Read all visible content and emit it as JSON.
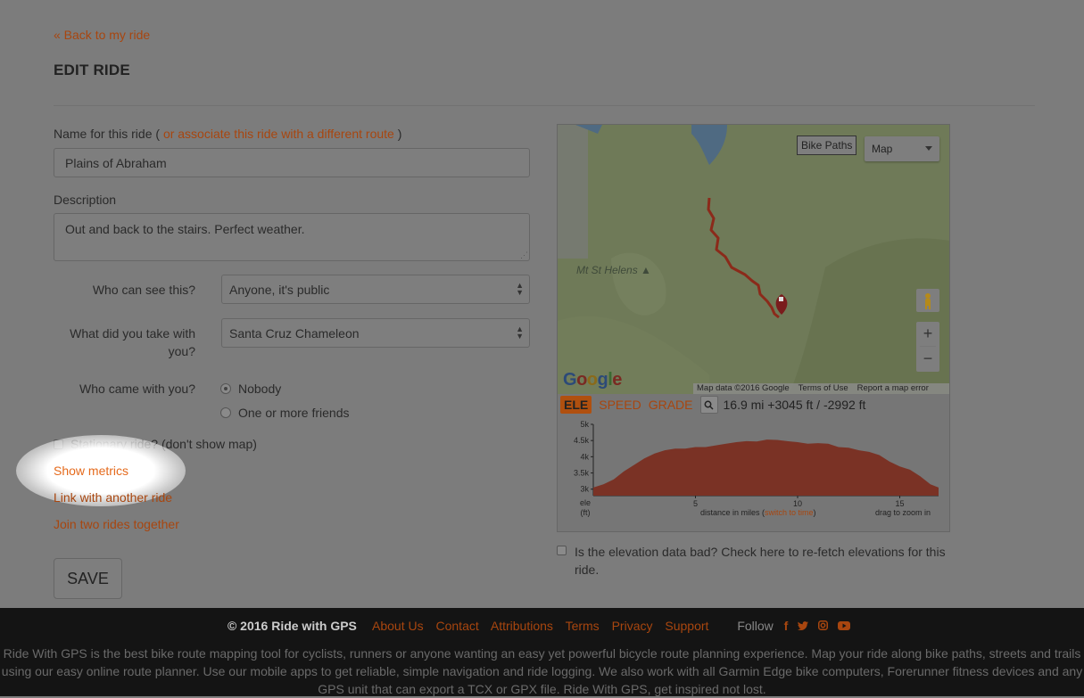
{
  "nav": {
    "back_link": "« Back to my ride"
  },
  "page": {
    "title": "EDIT RIDE"
  },
  "form": {
    "name_label": "Name for this ride",
    "name_label_open": "(",
    "name_label_close": ")",
    "associate_link": "or associate this ride with a different route",
    "name_value": "Plains of Abraham",
    "description_label": "Description",
    "description_value": "Out and back to the stairs. Perfect weather.",
    "visibility_label": "Who can see this?",
    "visibility_value": "Anyone, it's public",
    "gear_label": "What did you take with you?",
    "gear_value": "Santa Cruz Chameleon",
    "companions_label": "Who came with you?",
    "companions_options": [
      "Nobody",
      "One or more friends"
    ],
    "companions_selected": "Nobody",
    "stationary_label": "Stationary ride? (don't show map)",
    "stationary_checked": false,
    "show_metrics": "Show metrics",
    "link_ride": "Link with another ride",
    "join_rides": "Join two rides together",
    "save_label": "SAVE"
  },
  "map": {
    "bike_paths_label": "Bike Paths",
    "map_type_value": "Map",
    "place_label": "Mt St Helens",
    "google_logo": "Google",
    "attribution": "Map data ©2016 Google",
    "terms": "Terms of Use",
    "report_error": "Report a map error",
    "zoom_in": "+",
    "zoom_out": "−"
  },
  "elevation": {
    "tabs": [
      "ELE",
      "SPEED",
      "GRADE"
    ],
    "active_tab": "ELE",
    "stats": "16.9 mi +3045 ft / -2992 ft",
    "axis_label_top": "ele",
    "axis_label_unit": "(ft)",
    "x_caption": "distance in miles (",
    "x_caption_link": "switch to time",
    "x_caption_end": ")",
    "zoom_hint": "drag to zoom in"
  },
  "chart_data": {
    "type": "area",
    "x": [
      0,
      0.5,
      1,
      1.5,
      2,
      2.5,
      3,
      3.5,
      4,
      4.5,
      5,
      5.5,
      6,
      6.5,
      7,
      7.5,
      8,
      8.5,
      9,
      9.5,
      10,
      10.5,
      11,
      11.5,
      12,
      12.5,
      13,
      13.5,
      14,
      14.5,
      15,
      15.5,
      16,
      16.5,
      16.9
    ],
    "values": [
      3050,
      3150,
      3300,
      3550,
      3750,
      3950,
      4100,
      4200,
      4250,
      4250,
      4300,
      4300,
      4350,
      4400,
      4450,
      4480,
      4470,
      4530,
      4520,
      4480,
      4450,
      4400,
      4420,
      4400,
      4300,
      4280,
      4200,
      4150,
      4050,
      3850,
      3700,
      3600,
      3400,
      3150,
      3050
    ],
    "xlabel": "distance in miles",
    "ylabel": "ele (ft)",
    "x_ticks": [
      5,
      10,
      15
    ],
    "y_ticks": [
      "3k",
      "3.5k",
      "4k",
      "4.5k",
      "5k"
    ],
    "y_tick_values": [
      3000,
      3500,
      4000,
      4500,
      5000
    ],
    "xlim": [
      0,
      16.9
    ],
    "ylim": [
      2800,
      5000
    ],
    "fill_color": "#7a3225",
    "grid": false
  },
  "refetch": {
    "label": "Is the elevation data bad? Check here to re-fetch elevations for this ride.",
    "checked": false
  },
  "footer": {
    "copyright": "© 2016 Ride with GPS",
    "links": [
      "About Us",
      "Contact",
      "Attributions",
      "Terms",
      "Privacy",
      "Support"
    ],
    "follow_label": "Follow",
    "social_icons": [
      "facebook-icon",
      "twitter-icon",
      "instagram-icon",
      "youtube-icon"
    ],
    "blurb": "Ride With GPS is the best bike route mapping tool for cyclists, runners or anyone wanting an easy yet powerful bicycle route planning experience. Map your ride along bike paths, streets and trails using our easy online route planner. Use our mobile apps to get reliable, simple navigation and ride logging. We also work with all Garmin Edge bike computers, Forerunner fitness devices and any GPS unit that can export a TCX or GPX file. Ride With GPS, get inspired not lost."
  },
  "colors": {
    "accent": "#a8460f",
    "highlight": "#e56a1c",
    "overlay_bg": "#7c7c7c",
    "footer_bg": "#141414",
    "route_line": "#8b2a1a"
  }
}
